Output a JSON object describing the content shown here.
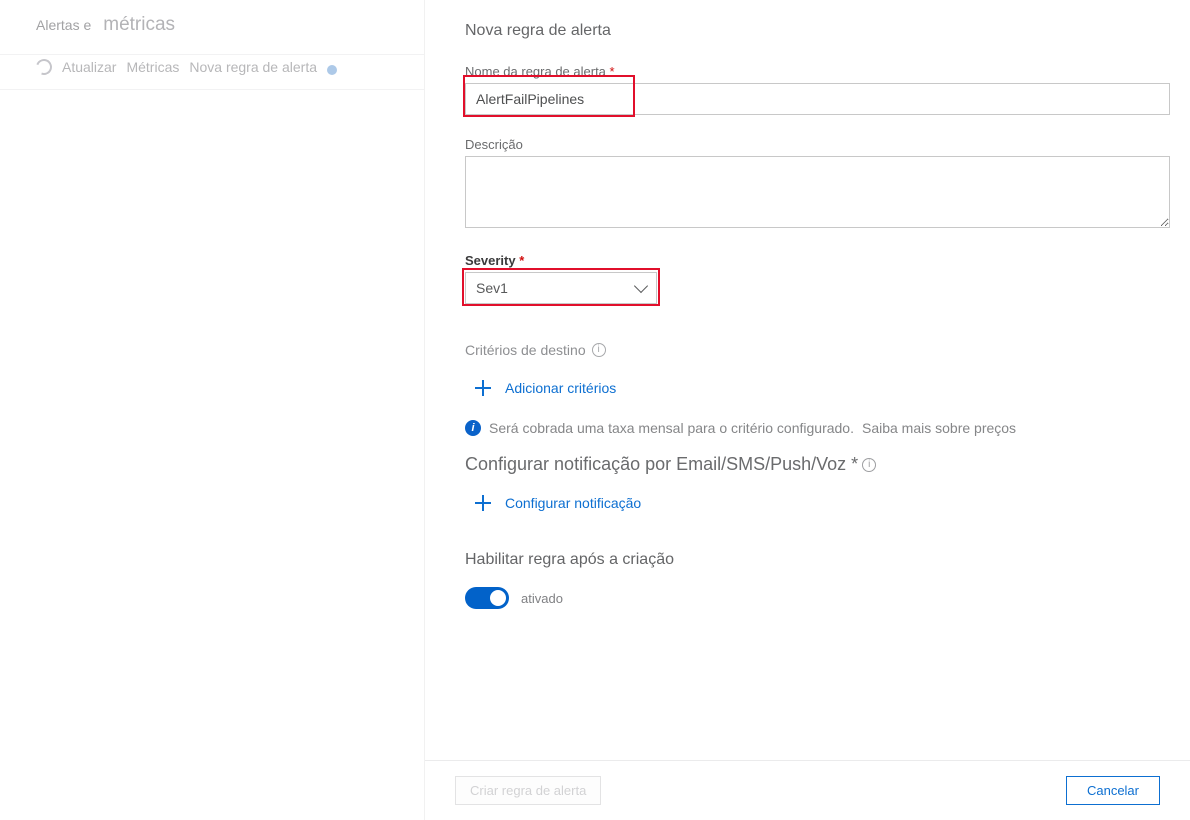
{
  "leftPanel": {
    "title1": "Alertas e",
    "title2": "métricas",
    "refresh": "Atualizar",
    "metrics": "Métricas",
    "newRule": "Nova regra de alerta"
  },
  "panel": {
    "title": "Nova regra de alerta",
    "nameLabel": "Nome da regra de alerta ",
    "nameValue": "AlertFailPipelines",
    "descLabel": "Descrição",
    "descValue": "",
    "severityLabel": "Severity",
    "severityValue": "Sev1",
    "criteriaHeading": "Critérios de destino",
    "addCriteria": "Adicionar critérios",
    "pricingInfo": "Será cobrada uma taxa mensal para o critério configurado.",
    "pricingLink": "Saiba mais sobre preços",
    "notifyHeading": "Configurar notificação por Email/SMS/Push/Voz *",
    "configureNotify": "Configurar notificação",
    "enableHeading": "Habilitar regra após a criação",
    "toggleLabel": "ativado"
  },
  "footer": {
    "create": "Criar regra de alerta",
    "cancel": "Cancelar"
  }
}
